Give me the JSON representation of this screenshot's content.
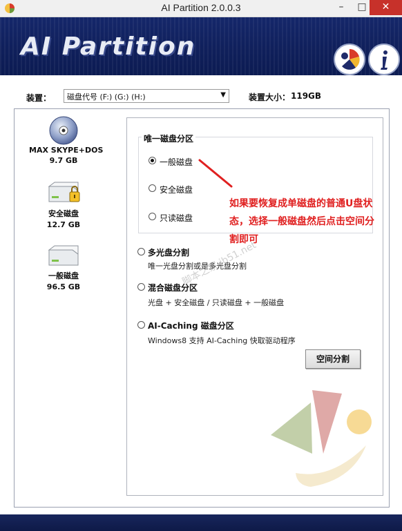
{
  "window": {
    "title": "AI Partition 2.0.0.3",
    "min_label": "–",
    "max_label": "□",
    "close_label": "✕"
  },
  "banner": {
    "title": "AI Partition"
  },
  "device": {
    "label": "装置：",
    "selected": "磁盘代号 (F:) (G:) (H:)",
    "size_label": "装置大小：",
    "size_value": "119GB"
  },
  "disks": [
    {
      "name": "MAX SKYPE+DOS",
      "size": "9.7 GB",
      "icon": "cd-disc-icon"
    },
    {
      "name": "安全磁盘",
      "size": "12.7 GB",
      "icon": "lock-drive-icon"
    },
    {
      "name": "一般磁盘",
      "size": "96.5 GB",
      "icon": "drive-icon"
    }
  ],
  "single_group": {
    "title": "唯一磁盘分区",
    "options": [
      {
        "label": "一般磁盘",
        "checked": true
      },
      {
        "label": "安全磁盘",
        "checked": false
      },
      {
        "label": "只读磁盘",
        "checked": false
      }
    ]
  },
  "modes": [
    {
      "label": "多光盘分割",
      "desc": "唯一光盘分割或是多光盘分割"
    },
    {
      "label": "混合磁盘分区",
      "desc": "光盘 + 安全磁盘 / 只读磁盘 + 一般磁盘"
    },
    {
      "label": "AI-Caching 磁盘分区",
      "desc": "Windows8 支持 AI-Caching 快取驱动程序"
    }
  ],
  "action_button": "空间分割",
  "annotation": "如果要恢复成单磁盘的普通U盘状态，选择一般磁盘然后点击空间分割即可",
  "watermark": "脚本之家 jb51.net",
  "colors": {
    "banner": "#15276a",
    "close_button": "#c7312a",
    "annotation": "#e02020"
  }
}
